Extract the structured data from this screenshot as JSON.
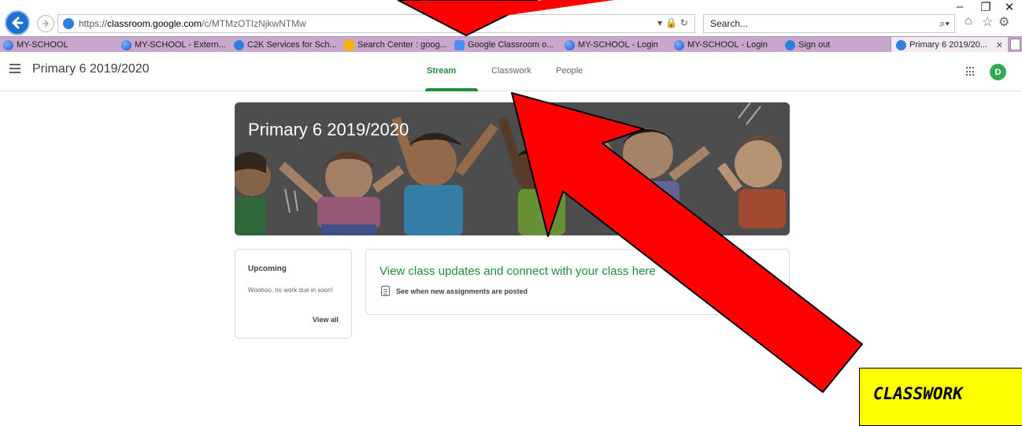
{
  "browser": {
    "url_scheme": "https://",
    "url_host": "classroom.google.com",
    "url_path": "/c/MTMzOTIzNjkwNTMw",
    "search_placeholder": "Search...",
    "favorites": [
      {
        "label": "MY-SCHOOL",
        "icon": "myschool-icon"
      },
      {
        "label": "MY-SCHOOL - Extern...",
        "icon": "myschool-icon"
      },
      {
        "label": "C2K Services for Sch...",
        "icon": "ie-icon"
      },
      {
        "label": "Search Center : goog...",
        "icon": "search-center-icon"
      },
      {
        "label": "Google Classroom o...",
        "icon": "google-classroom-icon"
      },
      {
        "label": "MY-SCHOOL - Login",
        "icon": "myschool-icon"
      },
      {
        "label": "MY-SCHOOL - Login",
        "icon": "myschool-icon"
      },
      {
        "label": "Sign out",
        "icon": "ie-icon"
      }
    ],
    "active_tab": "Primary 6 2019/20...",
    "window_controls": {
      "minimize": "–",
      "restore": "❐",
      "close": "✕"
    }
  },
  "classroom": {
    "class_name": "Primary 6 2019/2020",
    "tabs": {
      "stream": "Stream",
      "classwork": "Classwork",
      "people": "People"
    },
    "active_tab": "Stream",
    "avatar_letter": "D",
    "banner_title": "Primary 6 2019/2020",
    "upcoming": {
      "title": "Upcoming",
      "text": "Woohoo, no work due in soon!",
      "link": "View all"
    },
    "updates": {
      "title": "View class updates and connect with your class here",
      "subtitle": "See when new assignments are posted"
    }
  },
  "annotation": {
    "callout_text": "CLASSWORK",
    "arrow_color": "#ff0000",
    "callout_color": "#ffff00"
  },
  "colors": {
    "accent_green": "#1e8e3e",
    "favorites_bar": "#c9a7cd",
    "back_button": "#1f6fd1"
  }
}
